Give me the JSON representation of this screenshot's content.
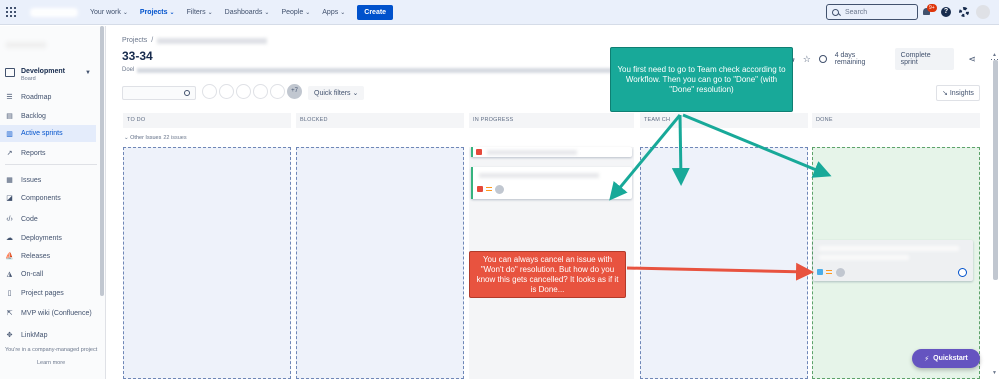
{
  "topnav": {
    "items": [
      {
        "label": "Your work"
      },
      {
        "label": "Projects"
      },
      {
        "label": "Filters"
      },
      {
        "label": "Dashboards"
      },
      {
        "label": "People"
      },
      {
        "label": "Apps"
      }
    ],
    "create_label": "Create",
    "search_placeholder": "Search",
    "notification_badge": "9+"
  },
  "sidebar": {
    "project_name": "Development",
    "project_sub": "Board",
    "items": [
      {
        "label": "Roadmap",
        "icon": "roadmap-icon"
      },
      {
        "label": "Backlog",
        "icon": "backlog-icon"
      },
      {
        "label": "Active sprints",
        "icon": "active-sprints-icon"
      },
      {
        "label": "Reports",
        "icon": "reports-icon"
      },
      {
        "label": "Issues",
        "icon": "issues-icon"
      },
      {
        "label": "Components",
        "icon": "components-icon"
      },
      {
        "label": "Code",
        "icon": "code-icon"
      },
      {
        "label": "Deployments",
        "icon": "deployments-icon"
      },
      {
        "label": "Releases",
        "icon": "releases-icon"
      },
      {
        "label": "On-call",
        "icon": "on-call-icon"
      },
      {
        "label": "Project pages",
        "icon": "project-pages-icon"
      },
      {
        "label": "MVP wiki (Confluence)",
        "icon": "confluence-icon"
      },
      {
        "label": "LinkMap",
        "icon": "linkmap-icon"
      }
    ],
    "footer": "You're in a company-managed project",
    "learn_more": "Learn more"
  },
  "header": {
    "breadcrumb_root": "Projects",
    "breadcrumb_sep": "/",
    "title": "33-34",
    "desc_prefix": "Doel",
    "days_remaining": "4 days remaining",
    "complete_label": "Complete sprint",
    "quick_filters": "Quick filters",
    "avatar_more": "+7",
    "insights": "Insights"
  },
  "board": {
    "columns": [
      "TO DO",
      "BLOCKED",
      "IN PROGRESS",
      "TEAM CH",
      "DONE"
    ],
    "swimlane": {
      "label": "Other Issues",
      "count": "22 issues"
    }
  },
  "annotations": {
    "teal": "You first need to go to Team check according to Workflow. Then you can go to \"Done\" (with \"Done\" resolution)",
    "red": "You can always cancel an issue with \"Won't do\" resolution. But how do you know this gets cancelled? It looks as if it is Done..."
  },
  "quickstart": "Quickstart",
  "colors": {
    "accent": "#0052cc",
    "teal_note": "#18a999",
    "red_note": "#e8533f",
    "done_column": "#e6f4e9",
    "quickstart": "#6554c0"
  }
}
